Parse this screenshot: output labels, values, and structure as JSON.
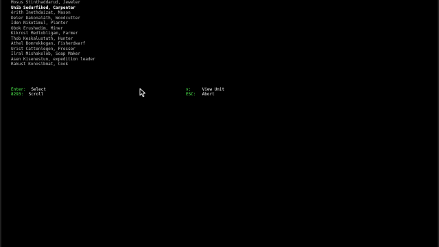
{
  "unit_list": {
    "items": [
      {
        "label": "Mosus Stinthaddarud, Jeweler",
        "selected": false
      },
      {
        "label": "Unib Sedurfikod, Carpenter",
        "selected": true
      },
      {
        "label": "ёrith Inethdaizat, Mason",
        "selected": false
      },
      {
        "label": "Deler Dakonaläth, Woodcutter",
        "selected": false
      },
      {
        "label": "Iden Nikotimul, Planter",
        "selected": false
      },
      {
        "label": "Obok Erushedim, Miner",
        "selected": false
      },
      {
        "label": "Kikrost Medtobligam, Farmer",
        "selected": false
      },
      {
        "label": "Thob Keskalustuth, Hunter",
        "selected": false
      },
      {
        "label": "Athel Bomrekkogan, Fisherdwarf",
        "selected": false
      },
      {
        "label": "Urist Cattenlegon, Presser",
        "selected": false
      },
      {
        "label": "Ilral Mishakolob, Soap Maker",
        "selected": false
      },
      {
        "label": "Asen Kisenestun, expedition leader",
        "selected": false
      },
      {
        "label": "Rakust Konoslbmat, Cook",
        "selected": false
      }
    ]
  },
  "hotkeys": {
    "enter": {
      "key": "Enter:",
      "action": "Select"
    },
    "scroll": {
      "key": "8293:",
      "action": "Scroll"
    },
    "view": {
      "key": "v:",
      "action": "View Unit"
    },
    "esc": {
      "key": "ESC:",
      "action": "Abort"
    }
  },
  "colors": {
    "background": "#000000",
    "text": "#c0c0c0",
    "selected": "#ffffff",
    "hotkey": "#55ff55"
  },
  "icons": {
    "cursor": "mouse-pointer-icon"
  }
}
